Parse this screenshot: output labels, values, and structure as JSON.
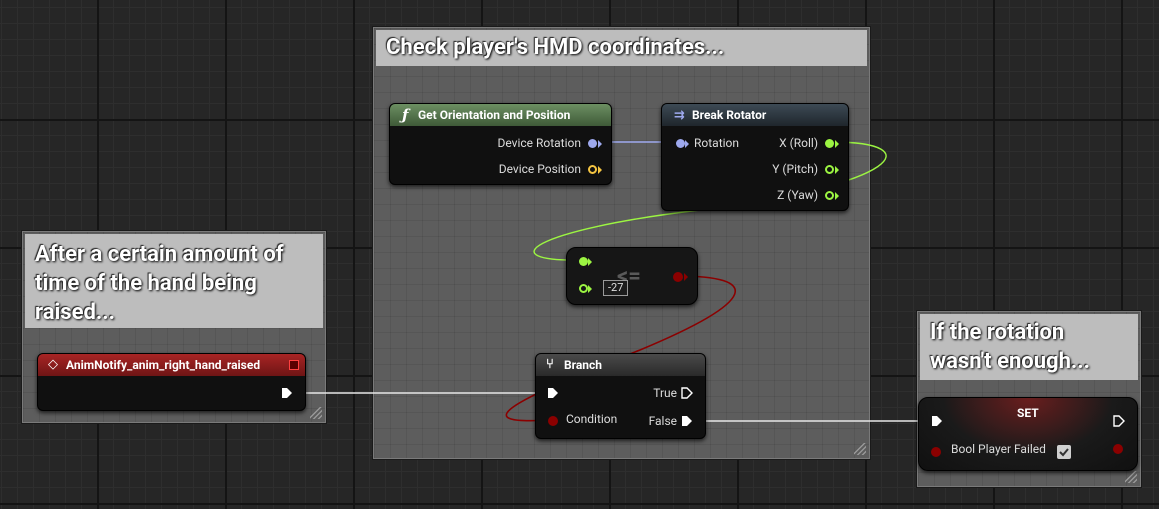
{
  "comments": {
    "hmd": {
      "title": "Check player's HMD coordinates..."
    },
    "anim": {
      "title": "After a certain amount of time of the hand being raised..."
    },
    "rotation": {
      "title": "If the rotation wasn't enough..."
    }
  },
  "nodes": {
    "get_orientation": {
      "title": "Get Orientation and Position",
      "icon": "function-icon",
      "pins": {
        "device_rotation": "Device Rotation",
        "device_position": "Device Position"
      }
    },
    "break_rotator": {
      "title": "Break Rotator",
      "icon": "break-struct-icon",
      "pins": {
        "rotation": "Rotation",
        "x_roll": "X (Roll)",
        "y_pitch": "Y (Pitch)",
        "z_yaw": "Z (Yaw)"
      }
    },
    "compare": {
      "operator": "<=",
      "literal_value": "-27"
    },
    "branch": {
      "title": "Branch",
      "icon": "branch-icon",
      "pins": {
        "condition": "Condition",
        "true": "True",
        "false": "False"
      }
    },
    "anim_notify": {
      "title": "AnimNotify_anim_right_hand_raised",
      "icon": "event-icon"
    },
    "set": {
      "title": "SET",
      "pins": {
        "bool_player_failed": "Bool Player Failed"
      },
      "checked": true
    }
  },
  "colors": {
    "exec": "#ffffff",
    "rotator": "#9ea9ee",
    "vector": "#f5c542",
    "float": "#9cf542",
    "bool": "#8b0000",
    "function_header": "#5a7d51",
    "event_header": "#8f1c1c"
  }
}
